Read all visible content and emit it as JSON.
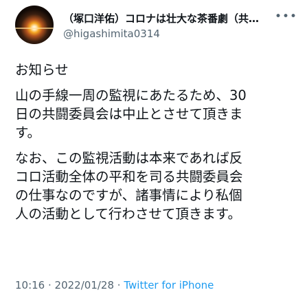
{
  "tweet": {
    "display_name": "（塚口洋佑）コロナは壮大な茶番劇（共…",
    "handle": "@higashimita0314",
    "more_icon": "more-dots-icon",
    "paragraphs": [
      "お知らせ",
      "山の手線一周の監視にあたるため、30\n日の共闘委員会は中止とさせて頂きま\nす。",
      "なお、この監視活動は本来であれば反\nコロ活動全体の平和を司る共闘委員会\nの仕事なのですが、諸事情により私個\n人の活動として行わさせて頂きます。"
    ],
    "time": "10:16",
    "separator1": " · ",
    "date": "2022/01/28",
    "separator2": " · ",
    "source": "Twitter for iPhone"
  },
  "colors": {
    "text": "#0f1419",
    "secondary": "#536471",
    "link": "#1d9bf0"
  }
}
